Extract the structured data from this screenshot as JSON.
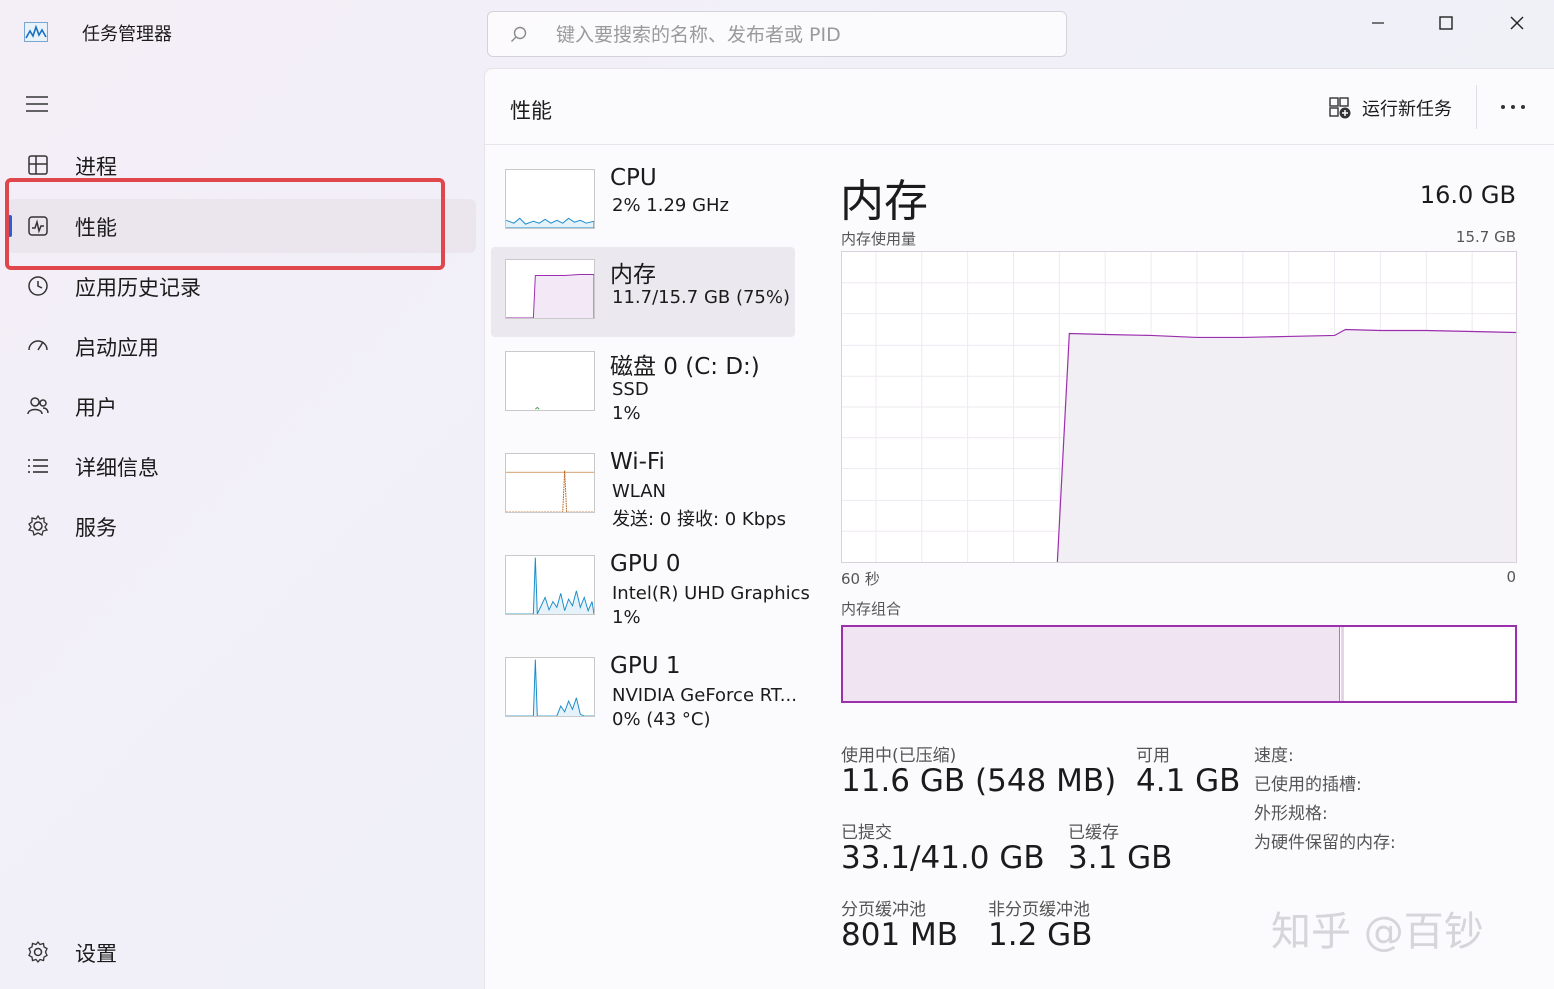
{
  "app": {
    "title": "任务管理器"
  },
  "search": {
    "placeholder": "键入要搜索的名称、发布者或 PID"
  },
  "sidebar": {
    "items": [
      {
        "label": "进程",
        "icon": "processes-icon"
      },
      {
        "label": "性能",
        "icon": "performance-icon",
        "active": true
      },
      {
        "label": "应用历史记录",
        "icon": "history-icon"
      },
      {
        "label": "启动应用",
        "icon": "startup-icon"
      },
      {
        "label": "用户",
        "icon": "users-icon"
      },
      {
        "label": "详细信息",
        "icon": "details-icon"
      },
      {
        "label": "服务",
        "icon": "services-icon"
      }
    ],
    "settings": {
      "label": "设置",
      "icon": "gear-icon"
    }
  },
  "header": {
    "title": "性能",
    "run_task": "运行新任务"
  },
  "devices": [
    {
      "name": "CPU",
      "line1": "2%  1.29 GHz",
      "line2": ""
    },
    {
      "name": "内存",
      "line1": "11.7/15.7 GB (75%)",
      "line2": "",
      "active": true
    },
    {
      "name": "磁盘 0 (C: D:)",
      "line1": "SSD",
      "line2": "1%"
    },
    {
      "name": "Wi-Fi",
      "line1": "WLAN",
      "line2": "发送: 0 接收: 0 Kbps"
    },
    {
      "name": "GPU 0",
      "line1": "Intel(R) UHD Graphics",
      "line2": "1%"
    },
    {
      "name": "GPU 1",
      "line1": "NVIDIA GeForce RT...",
      "line2": "0%  (43 °C)"
    }
  ],
  "memory": {
    "title": "内存",
    "total": "16.0 GB",
    "usage_label": "内存使用量",
    "usage_max": "15.7 GB",
    "time_left": "60 秒",
    "time_right": "0",
    "composition_label": "内存组合",
    "composition_in_use_fraction": 0.74,
    "stats": {
      "in_use_label": "使用中(已压缩)",
      "in_use_value": "11.6 GB (548 MB)",
      "available_label": "可用",
      "available_value": "4.1 GB",
      "committed_label": "已提交",
      "committed_value": "33.1/41.0 GB",
      "cached_label": "已缓存",
      "cached_value": "3.1 GB",
      "paged_label": "分页缓冲池",
      "paged_value": "801 MB",
      "nonpaged_label": "非分页缓冲池",
      "nonpaged_value": "1.2 GB"
    },
    "props": {
      "speed": "速度:",
      "slots": "已使用的插槽:",
      "form_factor": "外形规格:",
      "reserved": "为硬件保留的内存:"
    }
  },
  "colors": {
    "memory": "#9b2fae",
    "cpu": "#1a8cc8",
    "disk": "#3f9b3f",
    "wifi": "#b5651d",
    "gpu": "#1a8cc8",
    "accent": "#2b5fd9",
    "highlight": "#e0474c"
  },
  "watermark": "知乎 @百钞"
}
